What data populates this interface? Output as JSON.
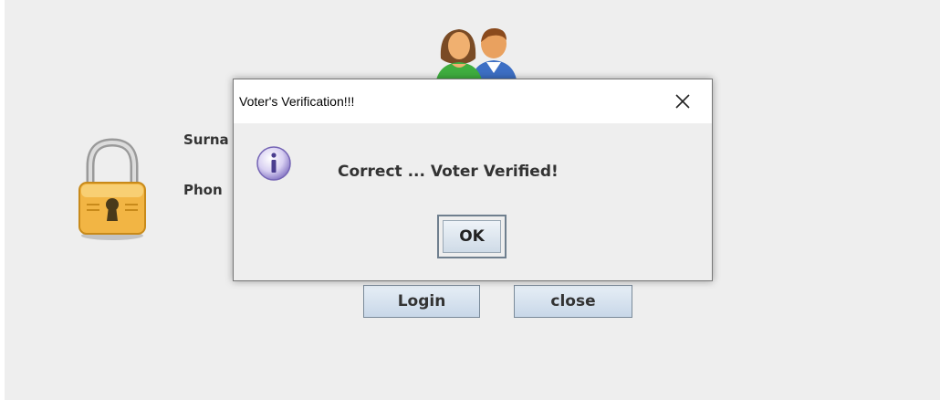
{
  "background_form": {
    "surname_label": "Surna",
    "phone_label": "Phon",
    "login_label": "Login",
    "close_label": "close"
  },
  "dialog": {
    "title": "Voter's Verification!!!",
    "message": "Correct ... Voter Verified!",
    "ok_label": "OK",
    "icon": "information-icon"
  },
  "icons": {
    "users": "users-icon",
    "lock": "padlock-icon",
    "close": "close-icon"
  },
  "colors": {
    "window_bg": "#eeeeee",
    "button_gradient_top": "#e6eef6",
    "button_gradient_bottom": "#c8d7e8",
    "lock_gold": "#f2b544",
    "info_purple": "#8e7fc9"
  }
}
